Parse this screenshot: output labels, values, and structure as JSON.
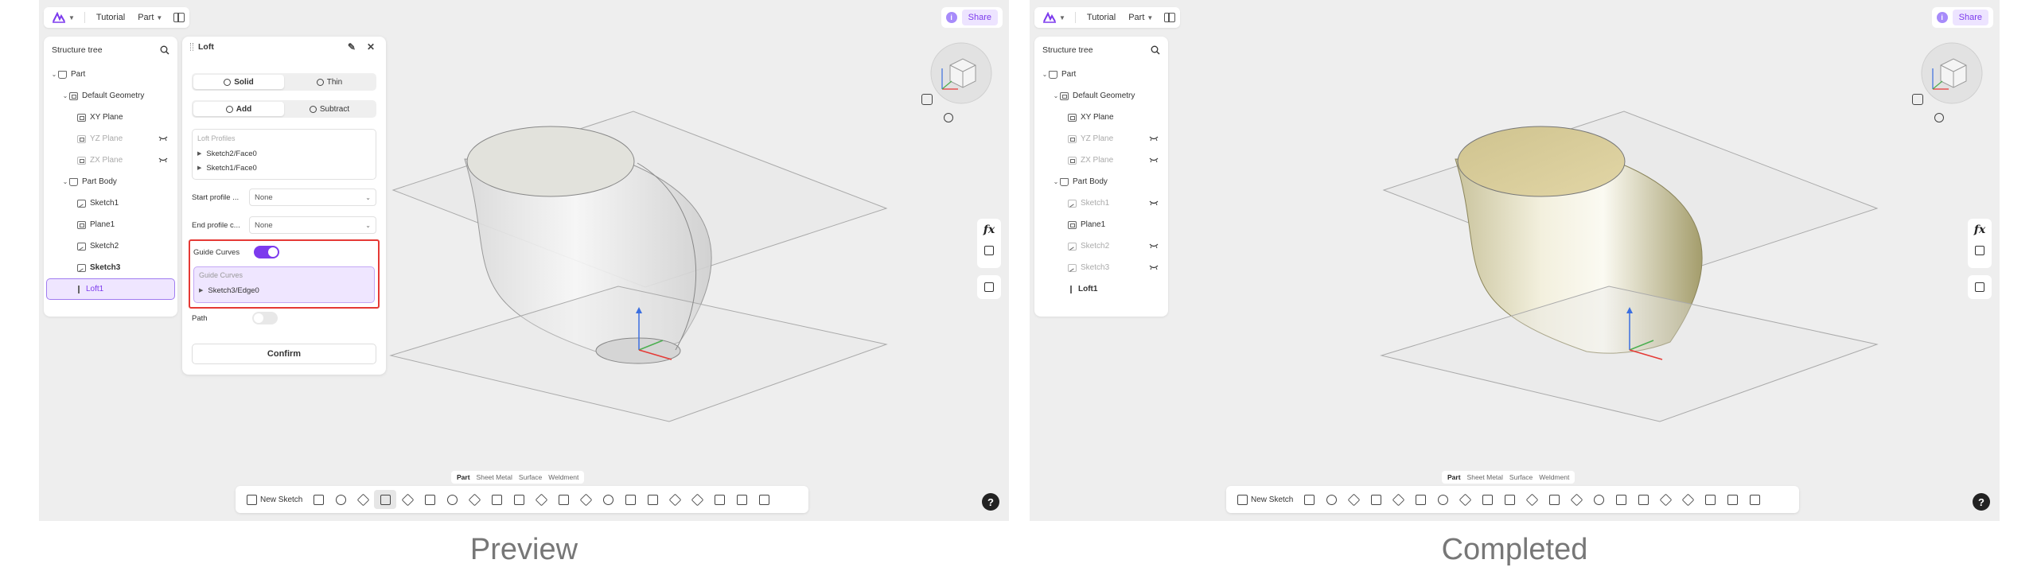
{
  "captions": {
    "left": "Preview",
    "right": "Completed"
  },
  "topbar": {
    "tutorial": "Tutorial",
    "part": "Part",
    "share": "Share"
  },
  "tree": {
    "title": "Structure tree",
    "left_items": [
      {
        "label": "Part"
      },
      {
        "label": "Default Geometry"
      },
      {
        "label": "XY Plane"
      },
      {
        "label": "YZ Plane"
      },
      {
        "label": "ZX Plane"
      },
      {
        "label": "Part Body"
      },
      {
        "label": "Sketch1"
      },
      {
        "label": "Plane1"
      },
      {
        "label": "Sketch2"
      },
      {
        "label": "Sketch3"
      },
      {
        "label": "Loft1"
      }
    ],
    "right_items": [
      {
        "label": "Part"
      },
      {
        "label": "Default Geometry"
      },
      {
        "label": "XY Plane"
      },
      {
        "label": "YZ Plane"
      },
      {
        "label": "ZX Plane"
      },
      {
        "label": "Part Body"
      },
      {
        "label": "Sketch1"
      },
      {
        "label": "Plane1"
      },
      {
        "label": "Sketch2"
      },
      {
        "label": "Sketch3"
      },
      {
        "label": "Loft1"
      }
    ]
  },
  "loft": {
    "title": "Loft",
    "solid": "Solid",
    "thin": "Thin",
    "add": "Add",
    "subtract": "Subtract",
    "profiles_label": "Loft Profiles",
    "profiles": [
      "Sketch2/Face0",
      "Sketch1/Face0"
    ],
    "start_label": "Start profile ...",
    "start_value": "None",
    "end_label": "End profile c...",
    "end_value": "None",
    "guide_label": "Guide Curves",
    "guide_inner_label": "Guide Curves",
    "guide_item": "Sketch3/Edge0",
    "path_label": "Path",
    "confirm": "Confirm"
  },
  "modes": [
    "Part",
    "Sheet Metal",
    "Surface",
    "Weldment"
  ],
  "toolbar": {
    "new_sketch": "New Sketch"
  },
  "side": {
    "fx": "fx"
  },
  "help": "?",
  "colors": {
    "accent": "#7c3aed",
    "highlight": "#e53935"
  }
}
